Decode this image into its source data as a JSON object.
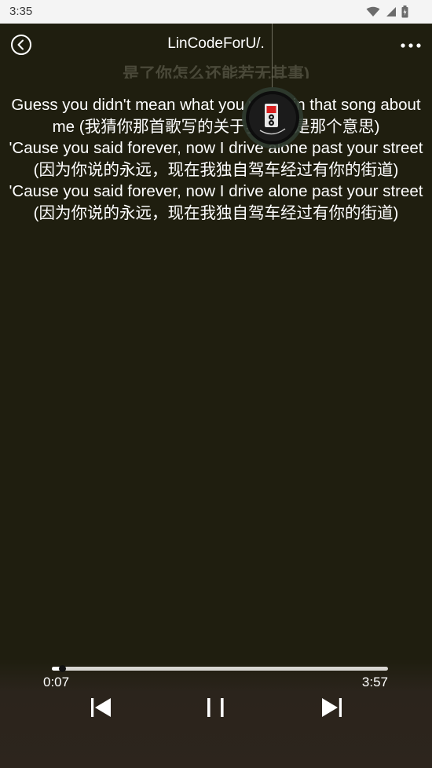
{
  "status_bar": {
    "time": "3:35",
    "icons": [
      "wifi-icon",
      "signal-icon",
      "battery-icon"
    ]
  },
  "header": {
    "title": "LinCodeForU/.",
    "back_icon": "back-circle-icon",
    "more_icon": "more-horizontal-icon"
  },
  "lyrics": {
    "previous_line": "是了你怎么还能若无其事)",
    "lines": [
      "Guess you didn't mean what you wrote in that song about me (我猜你那首歌写的关于我的不是那个意思)",
      "'Cause you said forever, now I drive alone past your street (因为你说的永远，现在我独自驾车经过有你的街道)",
      "'Cause you said forever, now I drive alone past your street (因为你说的永远，现在我独自驾车经过有你的街道)"
    ]
  },
  "player": {
    "current_time": "0:07",
    "total_time": "3:57",
    "progress": 0.03,
    "controls": {
      "prev_icon": "skip-previous-icon",
      "play_pause_icon": "pause-icon",
      "next_icon": "skip-next-icon"
    }
  },
  "colors": {
    "background": "#1f1e0f",
    "text": "#ffffff",
    "track": "#d8d6d2"
  }
}
